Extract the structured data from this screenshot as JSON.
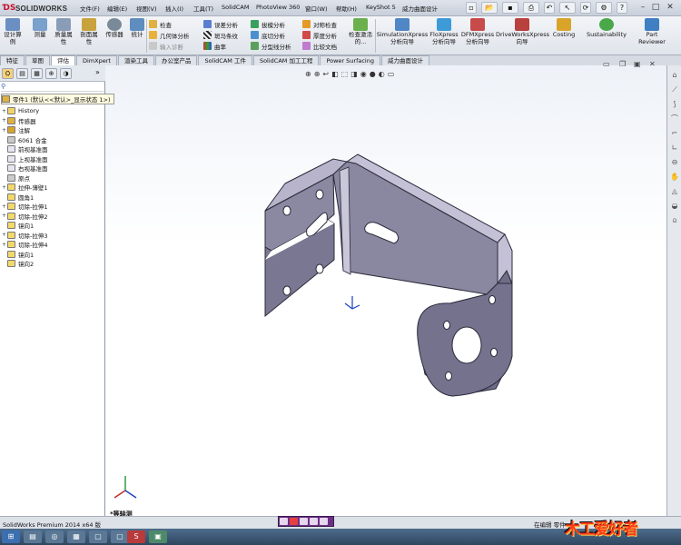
{
  "app": {
    "logo_text": "SOLIDWORKS"
  },
  "menu": {
    "items": [
      "文件(F)",
      "编辑(E)",
      "视图(V)",
      "插入(I)",
      "工具(T)",
      "SolidCAM",
      "PhotoView 360",
      "窗口(W)",
      "帮助(H)",
      "KeyShot 5",
      "威力曲面设计"
    ]
  },
  "command_manager": {
    "big_buttons": [
      {
        "label": "设计算例"
      },
      {
        "label": "测量"
      },
      {
        "label": "质量属性"
      },
      {
        "label": "剖面属性"
      },
      {
        "label": "传感器"
      },
      {
        "label": "统计"
      }
    ],
    "col1": [
      {
        "label": "检查"
      },
      {
        "label": "几何体分析"
      },
      {
        "label": "输入诊断"
      }
    ],
    "col2": [
      {
        "label": "误差分析"
      },
      {
        "label": "斑马条纹"
      },
      {
        "label": "曲率"
      }
    ],
    "col3": [
      {
        "label": "拔模分析"
      },
      {
        "label": "底切分析"
      },
      {
        "label": "分型线分析"
      }
    ],
    "col4": [
      {
        "label": "对称检查"
      },
      {
        "label": "厚度分析"
      },
      {
        "label": "比较文档"
      }
    ],
    "check_active": "检查激活的...",
    "xpress": [
      {
        "l1": "SimulationXpress",
        "l2": "分析向导"
      },
      {
        "l1": "FloXpress",
        "l2": "分析向导"
      },
      {
        "l1": "DFMXpress",
        "l2": "分析向导"
      },
      {
        "l1": "DriveWorksXpress",
        "l2": "向导"
      },
      {
        "l1": "Costing",
        "l2": ""
      },
      {
        "l1": "Sustainability",
        "l2": ""
      },
      {
        "l1": "Part",
        "l2": "Reviewer"
      }
    ]
  },
  "tabs": [
    "特征",
    "草图",
    "评估",
    "DimXpert",
    "渲染工具",
    "办公室产品",
    "SolidCAM 工件",
    "SolidCAM 加工工程",
    "Power Surfacing",
    "威力曲面设计"
  ],
  "active_tab": "评估",
  "tree": {
    "root": "零件1  (默认<<默认>_显示状态 1>)",
    "items": [
      "History",
      "传感器",
      "注解",
      "6061 合金",
      "前视基准面",
      "上视基准面",
      "右视基准面",
      "原点",
      "拉伸-薄壁1",
      "圆角1",
      "切除-拉伸1",
      "切除-拉伸2",
      "镜向1",
      "切除-拉伸3",
      "切除-拉伸4",
      "镜向1",
      "镜向2"
    ]
  },
  "viewport": {
    "view_name": "*等轴测"
  },
  "status": {
    "left": "SolidWorks Premium 2014 x64 版",
    "right": "在编辑 零件"
  },
  "watermark": "木工爱好者",
  "colors": {
    "part_face": "#7c7894",
    "part_light": "#b3b0c8",
    "part_edge": "#2c2a3a",
    "accent": "#c8102e"
  }
}
